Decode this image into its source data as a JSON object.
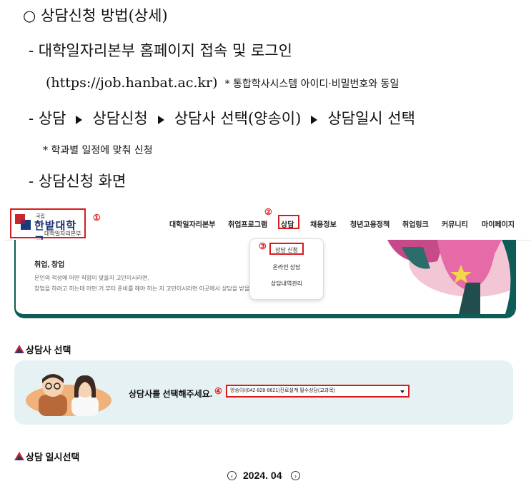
{
  "doc": {
    "heading": "○ 상담신청 방법(상세)",
    "step1_title": "- 대학일자리본부 홈페이지 접속 및 로그인",
    "step1_url": "(https://job.hanbat.ac.kr)",
    "step1_note": "* 통합학사시스템 아이디·비밀번호와 동일",
    "step2_prefix": "- ",
    "step2_items": [
      "상담",
      "상담신청",
      "상담사 선택(양송이)",
      "상담일시 선택"
    ],
    "step2_note": "* 학과별 일정에 맞춰 신청",
    "step3_title": "- 상담신청 화면"
  },
  "site": {
    "logo_small": "국립",
    "logo_name": "한밭대학교",
    "logo_sub": "대학일자리본부",
    "markers": [
      "①",
      "②",
      "③",
      "④"
    ],
    "nav": [
      "대학일자리본부",
      "취업프로그램",
      "상담",
      "채용정보",
      "청년고용정책",
      "취업링크",
      "커뮤니티",
      "마이페이지"
    ],
    "dropdown": [
      "상담 신청",
      "온라인 상담",
      "상담내역관리"
    ],
    "hero_title": "취업, 창업",
    "hero_line1": "본인의 적성에 어떤 직업이 맞을지 고민이시라면,",
    "hero_line2": "창업을 하려고 하는데 어떤 거 부터 준비를 해야 하는 지 고민이시라면 이곳에서 상담을 받을 수",
    "section1": "상담사 선택",
    "panel_label": "상담사를 선택해주세요.",
    "select_value": "양송이/(042-828-8621)진로설계 필수상담(교과목)",
    "section2": "상담 일시선택",
    "month": "2024. 04",
    "prev_icon": "chevron-left-circle-icon",
    "next_icon": "chevron-right-circle-icon",
    "accent": "#0e5b57",
    "highlight": "#d81b1b"
  }
}
